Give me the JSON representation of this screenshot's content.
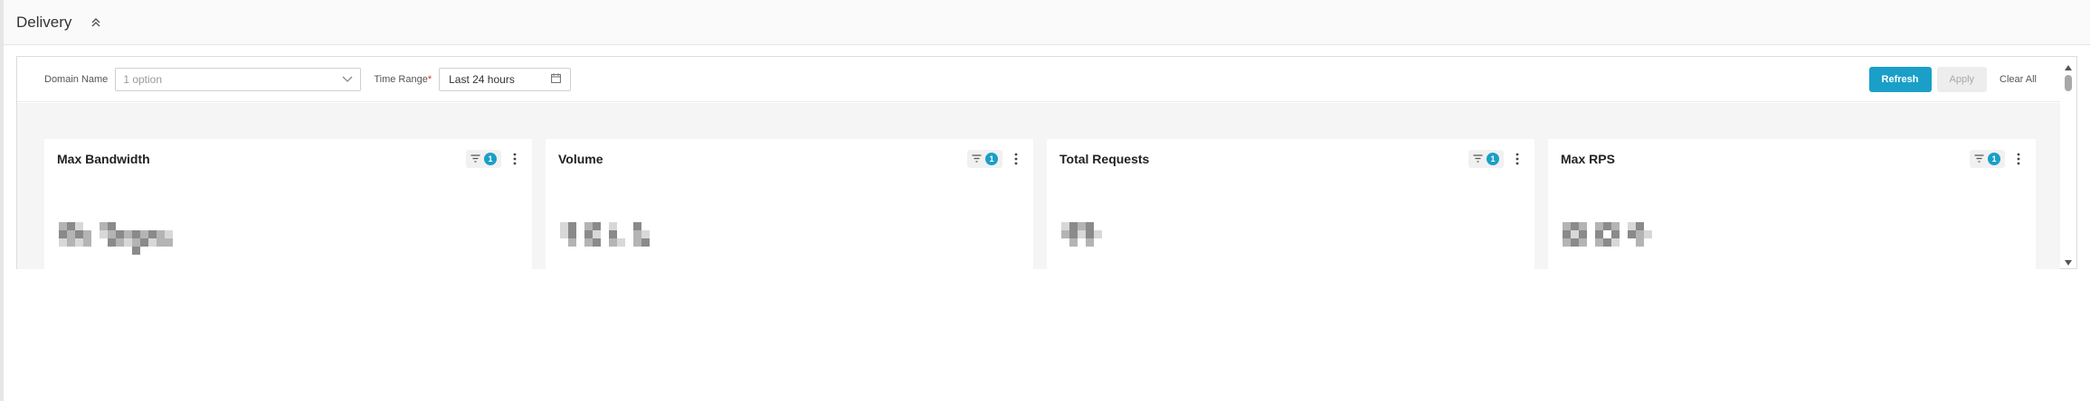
{
  "header": {
    "title": "Delivery",
    "collapse_icon": "chevron-double-up-icon"
  },
  "filters": {
    "domain_label": "Domain Name",
    "domain_placeholder": "1 option",
    "time_range_label": "Time Range",
    "time_range_required_mark": "*",
    "time_range_value": "Last 24 hours"
  },
  "actions": {
    "refresh_label": "Refresh",
    "apply_label": "Apply",
    "clear_label": "Clear All"
  },
  "cards": [
    {
      "title": "Max Bandwidth",
      "filter_count": "1"
    },
    {
      "title": "Volume",
      "filter_count": "1"
    },
    {
      "title": "Total Requests",
      "filter_count": "1"
    },
    {
      "title": "Max RPS",
      "filter_count": "1"
    }
  ],
  "colors": {
    "accent": "#1a9fc8",
    "pixel_dark": "#8a8a8a",
    "pixel_mid": "#b4b4b4",
    "pixel_light": "#d8d8d8"
  }
}
